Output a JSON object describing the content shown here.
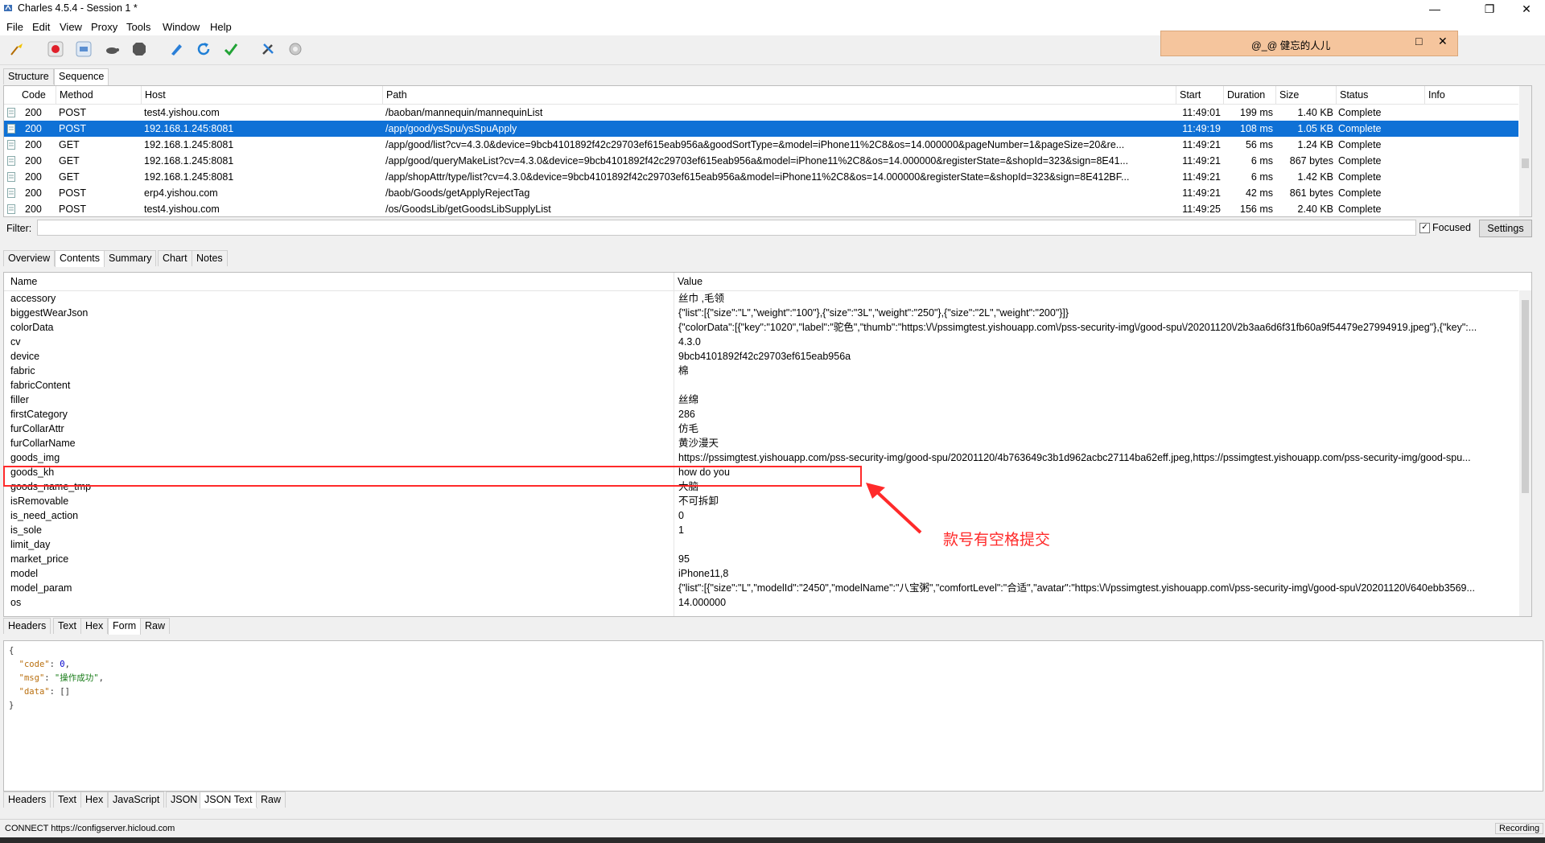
{
  "window": {
    "title": "Charles 4.5.4 - Session 1 *"
  },
  "menu": [
    "File",
    "Edit",
    "View",
    "Proxy",
    "Tools",
    "Window",
    "Help"
  ],
  "overlay": {
    "text": "@_@  健忘的人儿"
  },
  "top_tabs": [
    "Structure",
    "Sequence"
  ],
  "columns": [
    "Code",
    "Method",
    "Host",
    "Path",
    "Start",
    "Duration",
    "Size",
    "Status",
    "Info"
  ],
  "requests": [
    {
      "code": "200",
      "method": "POST",
      "host": "test4.yishou.com",
      "path": "/baoban/mannequin/mannequinList",
      "start": "11:49:01",
      "duration": "199 ms",
      "size": "1.40 KB",
      "status": "Complete"
    },
    {
      "code": "200",
      "method": "POST",
      "host": "192.168.1.245:8081",
      "path": "/app/good/ysSpu/ysSpuApply",
      "start": "11:49:19",
      "duration": "108 ms",
      "size": "1.05 KB",
      "status": "Complete"
    },
    {
      "code": "200",
      "method": "GET",
      "host": "192.168.1.245:8081",
      "path": "/app/good/list?cv=4.3.0&device=9bcb4101892f42c29703ef615eab956a&goodSortType=&model=iPhone11%2C8&os=14.000000&pageNumber=1&pageSize=20&re...",
      "start": "11:49:21",
      "duration": "56 ms",
      "size": "1.24 KB",
      "status": "Complete"
    },
    {
      "code": "200",
      "method": "GET",
      "host": "192.168.1.245:8081",
      "path": "/app/good/queryMakeList?cv=4.3.0&device=9bcb4101892f42c29703ef615eab956a&model=iPhone11%2C8&os=14.000000&registerState=&shopId=323&sign=8E41...",
      "start": "11:49:21",
      "duration": "6 ms",
      "size": "867 bytes",
      "status": "Complete"
    },
    {
      "code": "200",
      "method": "GET",
      "host": "192.168.1.245:8081",
      "path": "/app/shopAttr/type/list?cv=4.3.0&device=9bcb4101892f42c29703ef615eab956a&model=iPhone11%2C8&os=14.000000&registerState=&shopId=323&sign=8E412BF...",
      "start": "11:49:21",
      "duration": "6 ms",
      "size": "1.42 KB",
      "status": "Complete"
    },
    {
      "code": "200",
      "method": "POST",
      "host": "erp4.yishou.com",
      "path": "/baob/Goods/getApplyRejectTag",
      "start": "11:49:21",
      "duration": "42 ms",
      "size": "861 bytes",
      "status": "Complete"
    },
    {
      "code": "200",
      "method": "POST",
      "host": "test4.yishou.com",
      "path": "/os/GoodsLib/getGoodsLibSupplyList",
      "start": "11:49:25",
      "duration": "156 ms",
      "size": "2.40 KB",
      "status": "Complete"
    }
  ],
  "filter": {
    "label": "Filter:",
    "value": "",
    "focused_label": "Focused",
    "settings_label": "Settings"
  },
  "detail_tabs": [
    "Overview",
    "Contents",
    "Summary",
    "Chart",
    "Notes"
  ],
  "form_columns": {
    "name": "Name",
    "value": "Value"
  },
  "form_rows": [
    {
      "name": "accessory",
      "value": "丝巾 ,毛领"
    },
    {
      "name": "biggestWearJson",
      "value": "{\"list\":[{\"size\":\"L\",\"weight\":\"100\"},{\"size\":\"3L\",\"weight\":\"250\"},{\"size\":\"2L\",\"weight\":\"200\"}]}"
    },
    {
      "name": "colorData",
      "value": "{\"colorData\":[{\"key\":\"1020\",\"label\":\"驼色\",\"thumb\":\"https:\\/\\/pssimgtest.yishouapp.com\\/pss-security-img\\/good-spu\\/20201120\\/2b3aa6d6f31fb60a9f54479e27994919.jpeg\"},{\"key\":..."
    },
    {
      "name": "cv",
      "value": "4.3.0"
    },
    {
      "name": "device",
      "value": "9bcb4101892f42c29703ef615eab956a"
    },
    {
      "name": "fabric",
      "value": "棉"
    },
    {
      "name": "fabricContent",
      "value": ""
    },
    {
      "name": "filler",
      "value": "丝绵"
    },
    {
      "name": "firstCategory",
      "value": "286"
    },
    {
      "name": "furCollarAttr",
      "value": "仿毛"
    },
    {
      "name": "furCollarName",
      "value": "黄沙漫天"
    },
    {
      "name": "goods_img",
      "value": "https://pssimgtest.yishouapp.com/pss-security-img/good-spu/20201120/4b763649c3b1d962acbc27114ba62eff.jpeg,https://pssimgtest.yishouapp.com/pss-security-img/good-spu..."
    },
    {
      "name": "goods_kh",
      "value": "how do you"
    },
    {
      "name": "goods_name_tmp",
      "value": "大脑"
    },
    {
      "name": "isRemovable",
      "value": "不可拆卸"
    },
    {
      "name": "is_need_action",
      "value": "0"
    },
    {
      "name": "is_sole",
      "value": "1"
    },
    {
      "name": "limit_day",
      "value": ""
    },
    {
      "name": "market_price",
      "value": "95"
    },
    {
      "name": "model",
      "value": "iPhone11,8"
    },
    {
      "name": "model_param",
      "value": "{\"list\":[{\"size\":\"L\",\"modelId\":\"2450\",\"modelName\":\"八宝粥\",\"comfortLevel\":\"合适\",\"avatar\":\"https:\\/\\/pssimgtest.yishouapp.com\\/pss-security-img\\/good-spu\\/20201120\\/640ebb3569..."
    },
    {
      "name": "os",
      "value": "14.000000"
    }
  ],
  "annotation": {
    "text": "款号有空格提交",
    "color": "#ff2a2a"
  },
  "request_view_tabs": [
    "Headers",
    "Text",
    "Hex",
    "Form",
    "Raw"
  ],
  "response_json": {
    "code_key": "\"code\"",
    "code_val": "0",
    "msg_key": "\"msg\"",
    "msg_val": "\"操作成功\"",
    "data_key": "\"data\"",
    "data_val": "[]"
  },
  "response_view_tabs": [
    "Headers",
    "Text",
    "Hex",
    "JavaScript",
    "JSON",
    "JSON Text",
    "Raw"
  ],
  "status": {
    "text": "CONNECT https://configserver.hicloud.com",
    "recording": "Recording"
  },
  "colors": {
    "selection": "#0f71d6",
    "overlay_bg": "#f5c59d",
    "annotation": "#ff2a2a"
  }
}
